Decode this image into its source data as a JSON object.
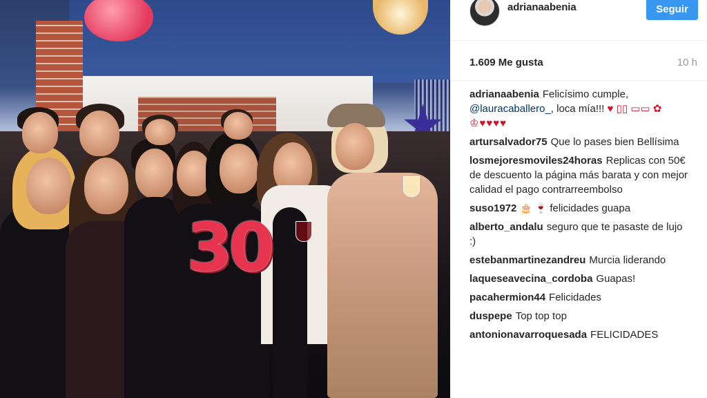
{
  "post": {
    "author": "adrianaabenia",
    "follow_label": "Seguir",
    "likes": "1.609 Me gusta",
    "time_ago": "10 h",
    "caption": {
      "user": "adrianaabenia",
      "text_before": "Felicísimo cumple,",
      "mention": "@lauracaballero_",
      "text_after": ", loca mía!!! ",
      "emojis": "♥ ▯▯ ▭▭ ✿",
      "hearts": "♔♥♥♥♥"
    }
  },
  "comments": [
    {
      "user": "artursalvador75",
      "text": "Que lo pases bien Bellísima"
    },
    {
      "user": "losmejoresmoviles24horas",
      "text": "Replicas con 50€ de descuento la página más barata y con mejor calidad el pago contrarreembolso"
    },
    {
      "user": "suso1972",
      "emoji": "🎂 🍷",
      "text": "felicidades guapa"
    },
    {
      "user": "alberto_andalu",
      "text": "seguro que te pasaste de lujo :)"
    },
    {
      "user": "estebanmartinezandreu",
      "text": "Murcia liderando"
    },
    {
      "user": "laqueseavecina_cordoba",
      "text": "Guapas!"
    },
    {
      "user": "pacahermion44",
      "text": "Felicidades"
    },
    {
      "user": "duspepe",
      "text": "Top top top"
    },
    {
      "user": "antonionavarroquesada",
      "text": "FELICIDADES"
    }
  ],
  "photo": {
    "number_decoration": "30"
  },
  "colors": {
    "follow_button": "#3897f0",
    "mention": "#003569",
    "heart": "#d1132a",
    "muted": "#999999"
  }
}
